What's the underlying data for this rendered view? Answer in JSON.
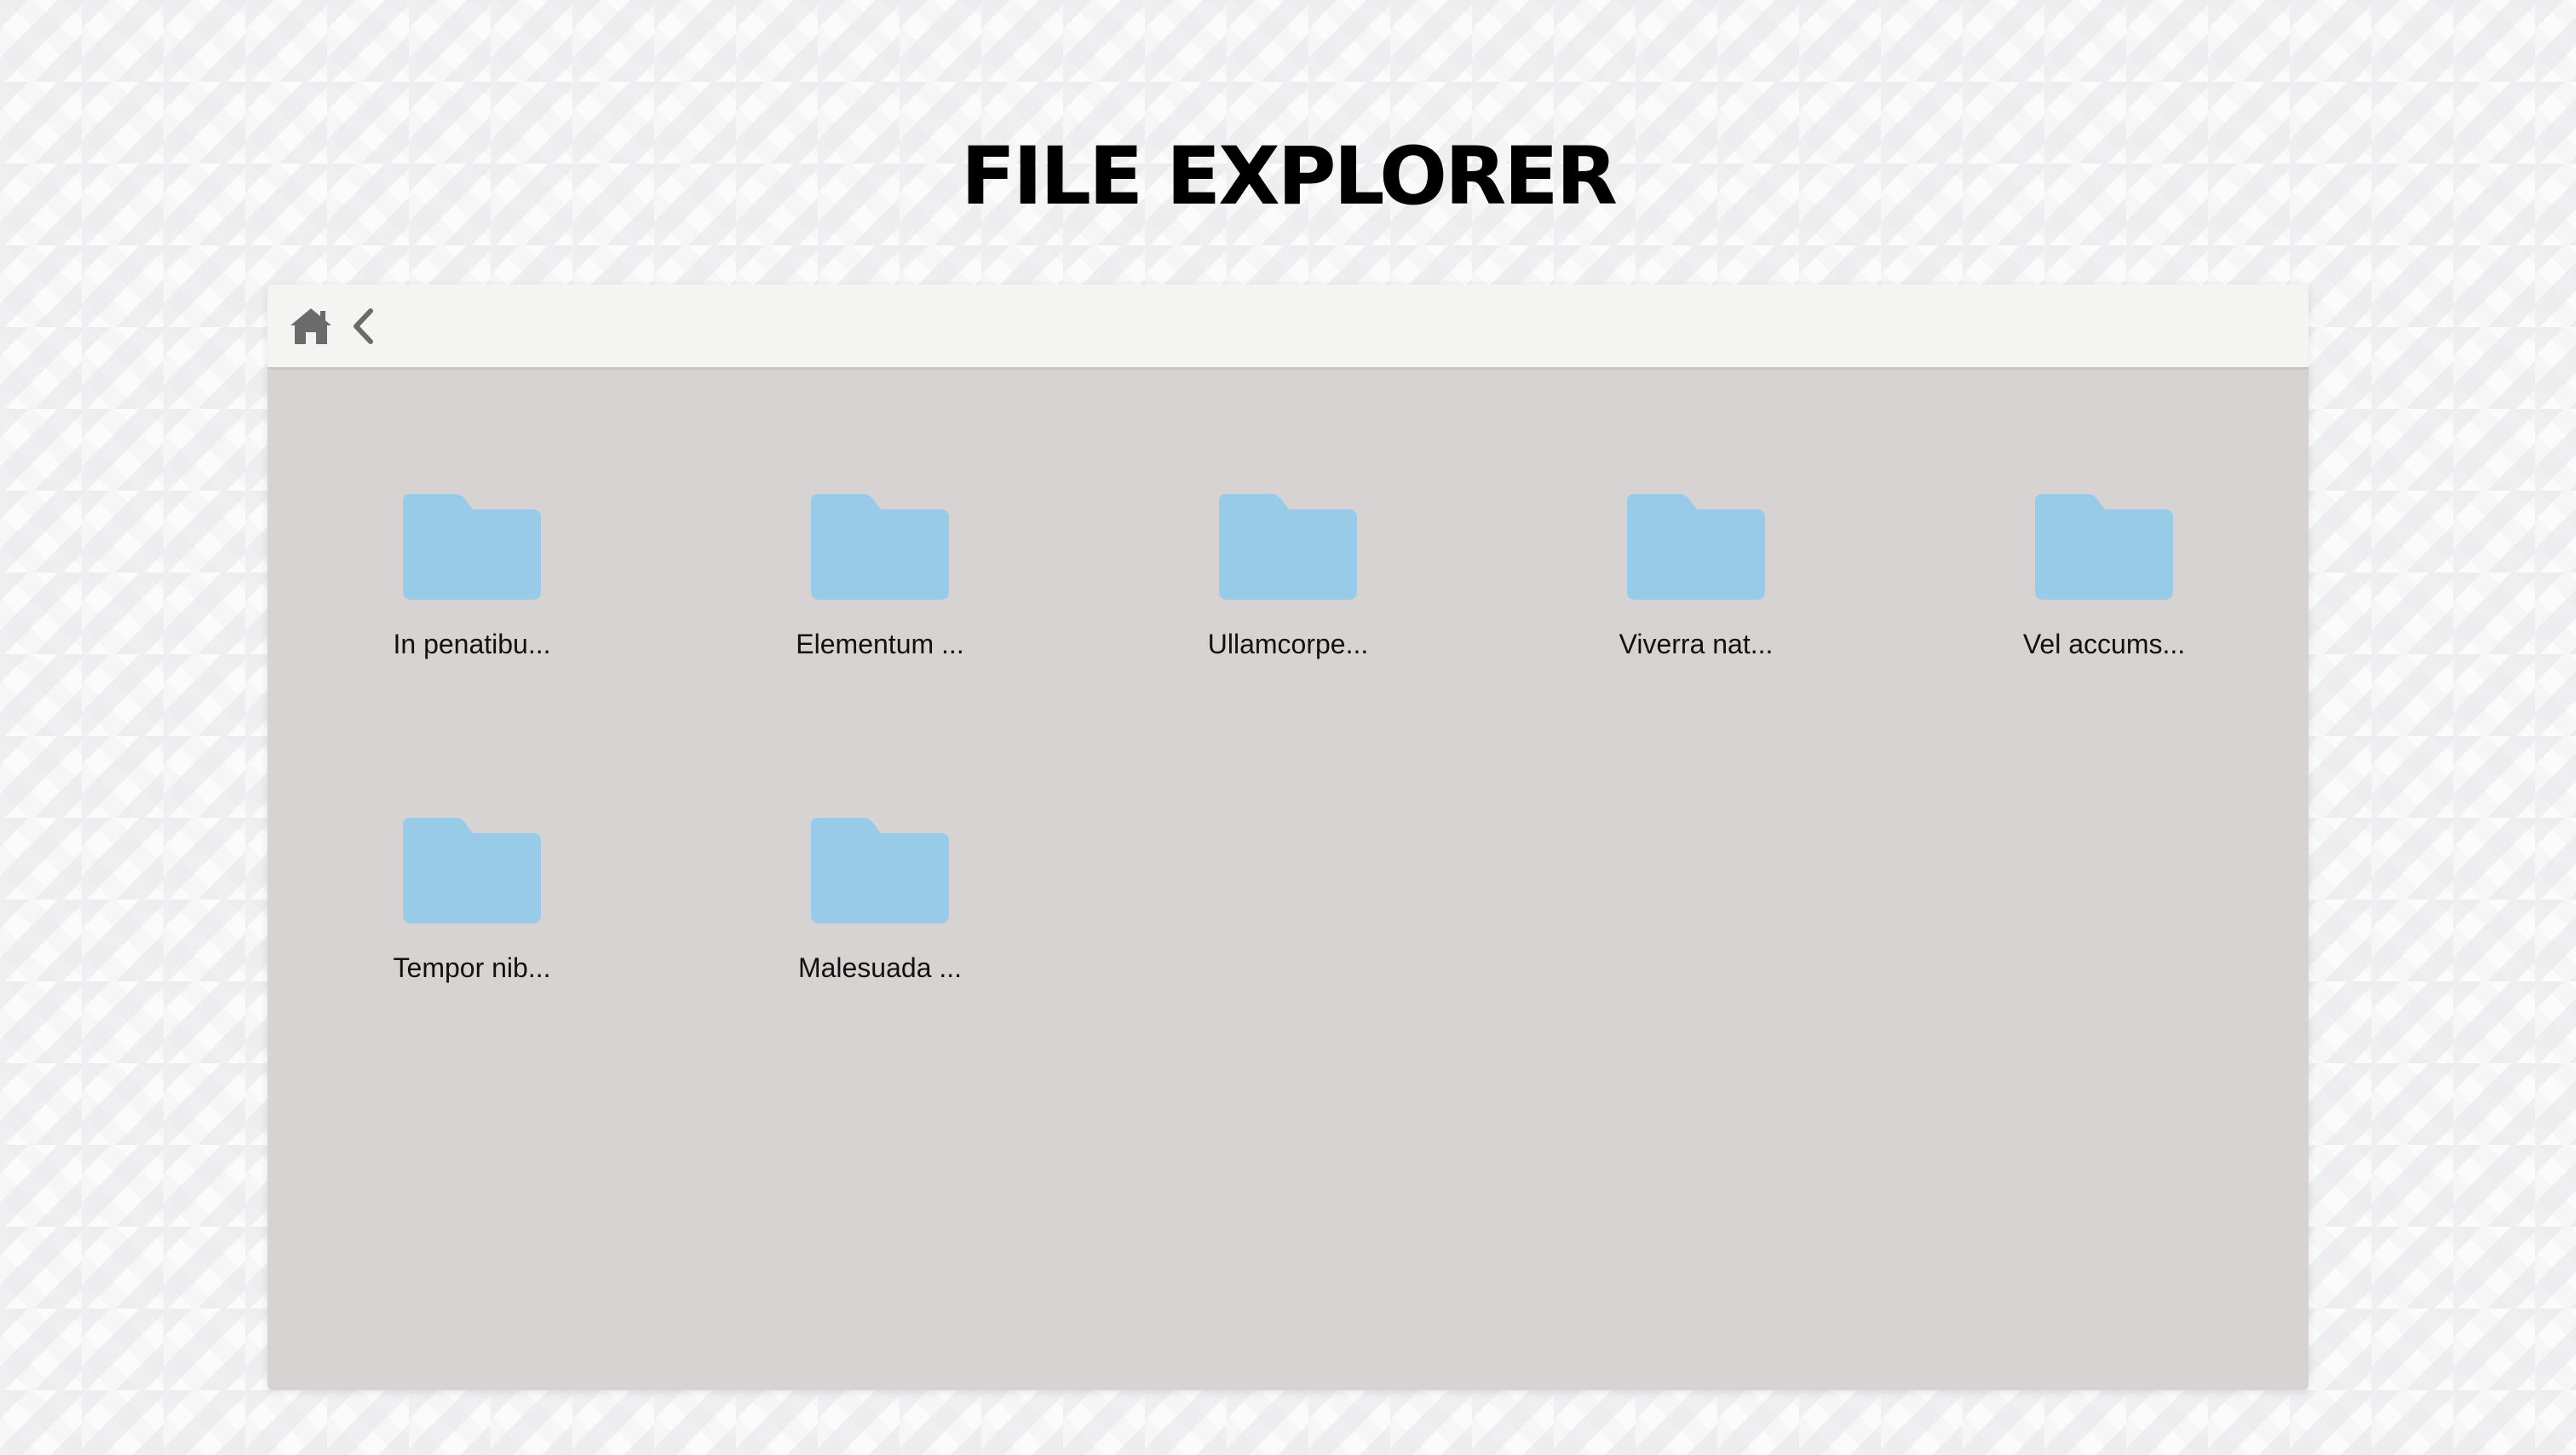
{
  "title": "FILE EXPLORER",
  "toolbar": {
    "home_icon": "home-icon",
    "back_icon": "chevron-left-icon"
  },
  "colors": {
    "folder": "#97cbe8",
    "toolbar_icon": "#6b6b6b",
    "content_bg": "#d6d3d2"
  },
  "folders": [
    {
      "label": "In penatibu..."
    },
    {
      "label": "Elementum ..."
    },
    {
      "label": "Ullamcorpe..."
    },
    {
      "label": "Viverra nat..."
    },
    {
      "label": "Vel accums..."
    },
    {
      "label": "Tempor nib..."
    },
    {
      "label": "Malesuada ..."
    }
  ]
}
